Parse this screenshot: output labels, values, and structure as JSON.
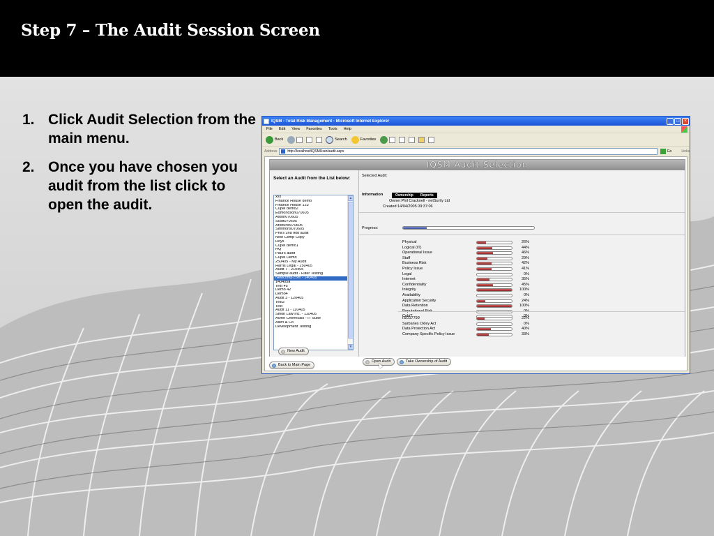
{
  "slide": {
    "title": "Step 7 – The Audit Session Screen",
    "steps": [
      {
        "num": "1.",
        "text": "Click Audit Selection from the main menu."
      },
      {
        "num": "2.",
        "text": "Once you have chosen you audit from the list click to open the audit."
      }
    ]
  },
  "browser": {
    "window_title": "IQSM - Total Risk Management - Microsoft Internet Explorer",
    "menu": [
      "File",
      "Edit",
      "View",
      "Favorites",
      "Tools",
      "Help"
    ],
    "toolbar": {
      "back": "Back",
      "search": "Search",
      "favorites": "Favorites"
    },
    "address_label": "Address",
    "address_url": "http://localhost/IQSMUser/audit.aspx",
    "go_label": "Go",
    "links_label": "Links"
  },
  "app": {
    "header_title": "IQSM Audit Selection",
    "list_heading": "Select an Audit from the List below:",
    "audits": [
      "xxx",
      "Finance House demo",
      "Finance House 123",
      "Cupel demo2",
      "Edmondson070605",
      "Aston070605",
      "Scott070605",
      "Arkhurst070605",
      "Simmons070605",
      "Phil's 2nd test audit",
      "New Comp Copy",
      "Roys",
      "Cupel demo1",
      "HQ",
      "Paul's audit",
      "Cupel Demo",
      "250405 - My Audit",
      "Harris Legal - 250405",
      "Audit 7 - 210405",
      "Sample audit - Filter Testing",
      "Newcomp.com - 140405",
      "140405a",
      "Test 45",
      "Demo 42",
      "Demo4",
      "Audit 3 - 120405",
      "Test2",
      "Test",
      "Audit 11 - 110405",
      "Smith Law Inc. - 110405",
      "Acme Chemicals - IT Suite",
      "Allen & Co",
      "Development Testing"
    ],
    "selected_audit": "Newcomp.com - 140405",
    "selected_audit_label": "Selected Audit:",
    "information_label": "Information",
    "info_tabs": [
      "Ownership",
      "Reports"
    ],
    "owner_text": "Owner:Phil Cracknell - netSurity Ltd",
    "created_text": "Created:14/04/2005 09:37:06",
    "progress_label": "Progress:",
    "progress_value": 0.18,
    "categories": [
      {
        "name": "Physical",
        "pct": "26%",
        "value": 26
      },
      {
        "name": "Logical (IT)",
        "pct": "44%",
        "value": 44
      },
      {
        "name": "Operational Issue",
        "pct": "46%",
        "value": 46
      },
      {
        "name": "Staff",
        "pct": "29%",
        "value": 29
      },
      {
        "name": "Business Risk",
        "pct": "42%",
        "value": 42
      },
      {
        "name": "Policy Issue",
        "pct": "41%",
        "value": 41
      },
      {
        "name": "Legal",
        "pct": "0%",
        "value": 0
      },
      {
        "name": "Internet",
        "pct": "35%",
        "value": 35
      },
      {
        "name": "Confidentiality",
        "pct": "45%",
        "value": 45
      },
      {
        "name": "Integrity",
        "pct": "100%",
        "value": 100
      },
      {
        "name": "Availability",
        "pct": "0%",
        "value": 0
      },
      {
        "name": "Application Security",
        "pct": "24%",
        "value": 24
      },
      {
        "name": "Data Retention",
        "pct": "100%",
        "value": 100
      },
      {
        "name": "Reputational Risk",
        "pct": "0%",
        "value": 0
      },
      {
        "name": "CobiT",
        "pct": "0%",
        "value": 0
      }
    ],
    "standards": [
      {
        "name": "ISO17799",
        "pct": "22%",
        "value": 22
      },
      {
        "name": "Sarbanes Oxley Act",
        "pct": "0%",
        "value": 0
      },
      {
        "name": "Data Protection Act",
        "pct": "40%",
        "value": 40
      },
      {
        "name": "Company Specific Policy Issue",
        "pct": "33%",
        "value": 33
      }
    ],
    "buttons": {
      "new_audit": "New Audit",
      "open_audit": "Open Audit",
      "take_ownership": "Take Ownership of Audit",
      "back_main": "Back to Main Page"
    }
  }
}
